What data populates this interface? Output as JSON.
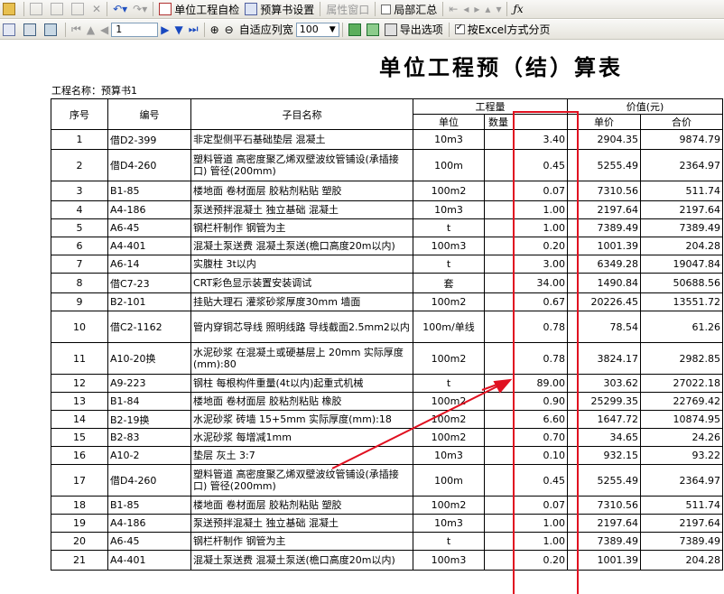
{
  "toolbar1": {
    "check_label": "单位工程自检",
    "budget_settings_label": "预算书设置",
    "attr_window_label": "属性窗口",
    "partial_summary_label": "局部汇总"
  },
  "toolbar2": {
    "page_value": "1",
    "auto_fit_label": "自适应列宽",
    "zoom_value": "100",
    "export_options_label": "导出选项",
    "excel_paging_label": "按Excel方式分页"
  },
  "report": {
    "title": "单位工程预（结）算表",
    "project_label": "工程名称：预算书1",
    "headers": {
      "no": "序号",
      "code": "编号",
      "name": "子目名称",
      "qty_group": "工程量",
      "unit": "单位",
      "qty": "数量",
      "value_group": "价值(元)",
      "price": "单价",
      "total": "合价"
    },
    "rows": [
      {
        "no": "1",
        "code": "借D2-399",
        "name": "非定型侧平石基础垫层 混凝土",
        "unit": "10m3",
        "qty": "3.40",
        "price": "2904.35",
        "total": "9874.79"
      },
      {
        "no": "2",
        "code": "借D4-260",
        "name": "塑料管道 高密度聚乙烯双壁波纹管铺设(承插接口) 管径(200mm)",
        "unit": "100m",
        "qty": "0.45",
        "price": "5255.49",
        "total": "2364.97"
      },
      {
        "no": "3",
        "code": "B1-85",
        "name": "楼地面 卷材面层 胶粘剂粘贴 塑胶",
        "unit": "100m2",
        "qty": "0.07",
        "price": "7310.56",
        "total": "511.74"
      },
      {
        "no": "4",
        "code": "A4-186",
        "name": "泵送预拌混凝土 独立基础 混凝土",
        "unit": "10m3",
        "qty": "1.00",
        "price": "2197.64",
        "total": "2197.64"
      },
      {
        "no": "5",
        "code": "A6-45",
        "name": "钢栏杆制作 钢管为主",
        "unit": "t",
        "qty": "1.00",
        "price": "7389.49",
        "total": "7389.49"
      },
      {
        "no": "6",
        "code": "A4-401",
        "name": "混凝土泵送费 混凝土泵送(檐口高度20m以内)",
        "unit": "100m3",
        "qty": "0.20",
        "price": "1001.39",
        "total": "204.28"
      },
      {
        "no": "7",
        "code": "A6-14",
        "name": "实腹柱 3t以内",
        "unit": "t",
        "qty": "3.00",
        "price": "6349.28",
        "total": "19047.84"
      },
      {
        "no": "8",
        "code": "借C7-23",
        "name": "CRT彩色显示装置安装调试",
        "unit": "套",
        "qty": "34.00",
        "price": "1490.84",
        "total": "50688.56"
      },
      {
        "no": "9",
        "code": "B2-101",
        "name": "挂贴大理石 灌浆砂浆厚度30mm 墙面",
        "unit": "100m2",
        "qty": "0.67",
        "price": "20226.45",
        "total": "13551.72"
      },
      {
        "no": "10",
        "code": "借C2-1162",
        "name": "管内穿铜芯导线 照明线路 导线截面2.5mm2以内",
        "unit": "100m/单线",
        "qty": "0.78",
        "price": "78.54",
        "total": "61.26"
      },
      {
        "no": "11",
        "code": "A10-20换",
        "name": "水泥砂浆 在混凝土或硬基层上 20mm 实际厚度(mm):80",
        "unit": "100m2",
        "qty": "0.78",
        "price": "3824.17",
        "total": "2982.85"
      },
      {
        "no": "12",
        "code": "A9-223",
        "name": "钢柱 每根构件重量(4t以内)起重式机械",
        "unit": "t",
        "qty": "89.00",
        "price": "303.62",
        "total": "27022.18"
      },
      {
        "no": "13",
        "code": "B1-84",
        "name": "楼地面 卷材面层 胶粘剂粘贴 橡胶",
        "unit": "100m2",
        "qty": "0.90",
        "price": "25299.35",
        "total": "22769.42"
      },
      {
        "no": "14",
        "code": "B2-19换",
        "name": "水泥砂浆 砖墙 15+5mm 实际厚度(mm):18",
        "unit": "100m2",
        "qty": "6.60",
        "price": "1647.72",
        "total": "10874.95"
      },
      {
        "no": "15",
        "code": "B2-83",
        "name": "水泥砂浆 每增减1mm",
        "unit": "100m2",
        "qty": "0.70",
        "price": "34.65",
        "total": "24.26"
      },
      {
        "no": "16",
        "code": "A10-2",
        "name": "垫层 灰土 3:7",
        "unit": "10m3",
        "qty": "0.10",
        "price": "932.15",
        "total": "93.22"
      },
      {
        "no": "17",
        "code": "借D4-260",
        "name": "塑料管道 高密度聚乙烯双壁波纹管铺设(承插接口) 管径(200mm)",
        "unit": "100m",
        "qty": "0.45",
        "price": "5255.49",
        "total": "2364.97"
      },
      {
        "no": "18",
        "code": "B1-85",
        "name": "楼地面 卷材面层 胶粘剂粘贴 塑胶",
        "unit": "100m2",
        "qty": "0.07",
        "price": "7310.56",
        "total": "511.74"
      },
      {
        "no": "19",
        "code": "A4-186",
        "name": "泵送预拌混凝土 独立基础 混凝土",
        "unit": "10m3",
        "qty": "1.00",
        "price": "2197.64",
        "total": "2197.64"
      },
      {
        "no": "20",
        "code": "A6-45",
        "name": "钢栏杆制作 钢管为主",
        "unit": "t",
        "qty": "1.00",
        "price": "7389.49",
        "total": "7389.49"
      },
      {
        "no": "21",
        "code": "A4-401",
        "name": "混凝土泵送费 混凝土泵送(檐口高度20m以内)",
        "unit": "100m3",
        "qty": "0.20",
        "price": "1001.39",
        "total": "204.28"
      }
    ]
  },
  "annotation": {
    "highlight_color": "#e01020",
    "arrow_color": "#e01020"
  }
}
